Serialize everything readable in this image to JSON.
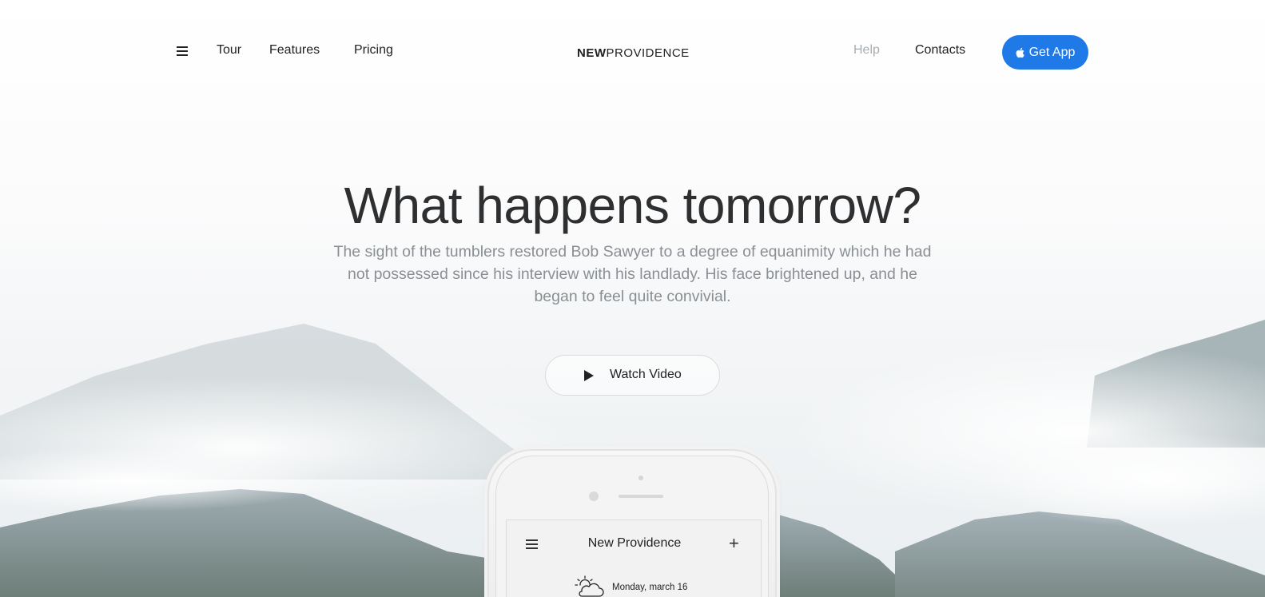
{
  "nav": {
    "links_left": [
      "Tour",
      "Features",
      "Pricing"
    ],
    "logo_bold": "NEW",
    "logo_light": "PROVIDENCE",
    "help": "Help",
    "contacts": "Contacts",
    "get_app": "Get App"
  },
  "hero": {
    "headline": "What happens tomorrow?",
    "subtext": "The sight of the tumblers restored Bob Sawyer to a degree of equanimity which he had not possessed since his interview with his landlady. His face brightened up, and he began to feel quite convivial.",
    "watch_video": "Watch Video"
  },
  "phone": {
    "app_title": "New Providence",
    "date": "Monday, march 16"
  },
  "colors": {
    "accent": "#1f7ae8",
    "headline": "#2e2f30",
    "subtext": "#8a8f94",
    "help": "#a8adb2"
  }
}
